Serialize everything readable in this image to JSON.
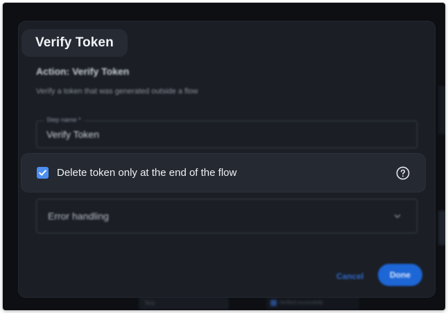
{
  "modal": {
    "title": "Verify Token",
    "action_title": "Action: Verify Token",
    "action_description": "Verify a token that was generated outside a flow",
    "step_name": {
      "label": "Step name *",
      "value": "Verify Token"
    },
    "delete_token_option": {
      "label": "Delete token only at the end of the flow",
      "checked": true,
      "help_icon": "help-circle-icon"
    },
    "error_handling": {
      "label": "Error handling",
      "icon": "chevron-down-icon"
    },
    "cancel_label": "Cancel",
    "done_label": "Done"
  },
  "background": {
    "bottom_left_text": "Tery",
    "bottom_right_text": "Verified successfully"
  },
  "colors": {
    "accent": "#4d8ff0",
    "primary_button": "#1d66d6",
    "modal_bg": "#1b1e25",
    "highlight_row_bg": "#252932",
    "page_bg": "#0d0f13"
  }
}
